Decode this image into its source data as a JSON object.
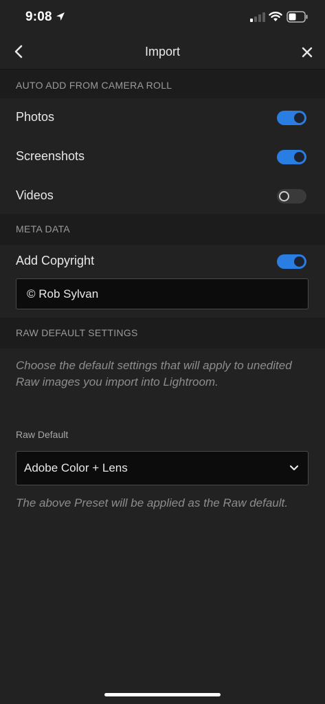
{
  "status_bar": {
    "time": "9:08"
  },
  "header": {
    "title": "Import"
  },
  "sections": {
    "auto_add": {
      "title": "AUTO ADD FROM CAMERA ROLL",
      "photos_label": "Photos",
      "photos_on": true,
      "screenshots_label": "Screenshots",
      "screenshots_on": true,
      "videos_label": "Videos",
      "videos_on": false
    },
    "metadata": {
      "title": "META DATA",
      "copyright_label": "Add Copyright",
      "copyright_on": true,
      "copyright_value": "© Rob Sylvan"
    },
    "raw": {
      "title": "RAW DEFAULT SETTINGS",
      "description": "Choose the default settings that will apply to unedited Raw images you import into Lightroom.",
      "raw_default_label": "Raw Default",
      "raw_default_value": "Adobe Color + Lens",
      "note": "The above Preset will be applied as the Raw default."
    }
  },
  "colors": {
    "background": "#222222",
    "section_header_bg": "#1c1c1c",
    "accent": "#2a7de1",
    "muted_text": "#8d8d8d"
  },
  "icons": {
    "back": "chevron-left-icon",
    "close": "close-icon",
    "dropdown": "chevron-down-icon",
    "location": "location-arrow-icon",
    "signal": "cellular-signal-icon",
    "wifi": "wifi-icon",
    "battery": "battery-icon"
  }
}
